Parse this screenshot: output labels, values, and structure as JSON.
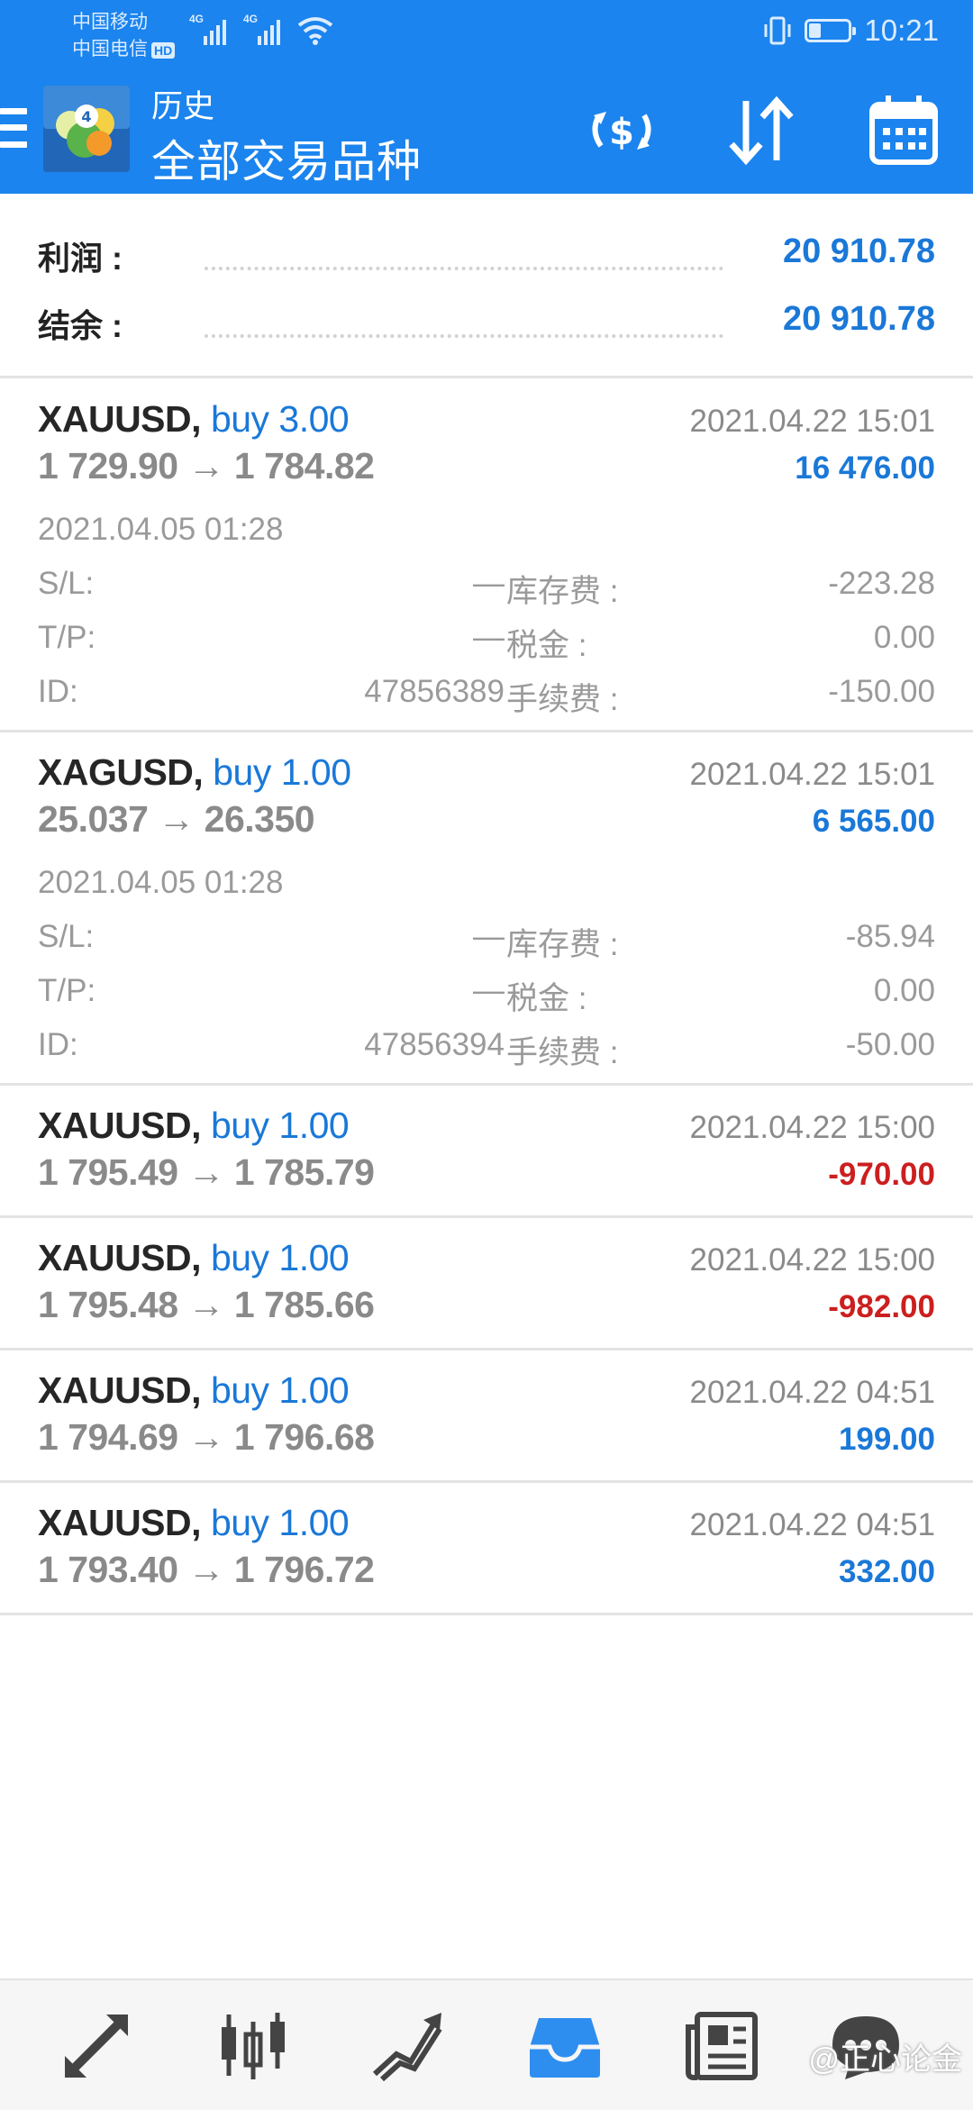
{
  "status_bar": {
    "carrier_1": "中国移动",
    "carrier_2": "中国电信",
    "hd_badge": "HD",
    "network_1": "4G",
    "network_2": "4G",
    "battery_level": 0.3,
    "time": "10:21"
  },
  "header": {
    "title": "历史",
    "subtitle": "全部交易品种",
    "bg_color": "#1b84ee"
  },
  "summary": {
    "profit_label": "利润 :",
    "profit_value": "20 910.78",
    "balance_label": "结余 :",
    "balance_value": "20 910.78"
  },
  "deals": [
    {
      "symbol": "XAUUSD,",
      "side": "buy 3.00",
      "prices": "1 729.90 → 1 784.82",
      "close_time": "2021.04.22 15:01",
      "profit": "16 476.00",
      "open_time": "2021.04.05 01:28",
      "sl_label": "S/L:",
      "sl": "—",
      "tp_label": "T/P:",
      "tp": "—",
      "id_label": "ID:",
      "id": "47856389",
      "swap_label": "库存费 :",
      "swap": "-223.28",
      "tax_label": "税金 :",
      "tax": "0.00",
      "fee_label": "手续费 :",
      "fee": "-150.00"
    },
    {
      "symbol": "XAGUSD,",
      "side": "buy 1.00",
      "prices": "25.037 → 26.350",
      "close_time": "2021.04.22 15:01",
      "profit": "6 565.00",
      "open_time": "2021.04.05 01:28",
      "sl_label": "S/L:",
      "sl": "—",
      "tp_label": "T/P:",
      "tp": "—",
      "id_label": "ID:",
      "id": "47856394",
      "swap_label": "库存费 :",
      "swap": "-85.94",
      "tax_label": "税金 :",
      "tax": "0.00",
      "fee_label": "手续费 :",
      "fee": "-50.00"
    },
    {
      "symbol": "XAUUSD,",
      "side": "buy 1.00",
      "prices": "1 795.49 → 1 785.79",
      "close_time": "2021.04.22 15:00",
      "profit": "-970.00"
    },
    {
      "symbol": "XAUUSD,",
      "side": "buy 1.00",
      "prices": "1 795.48 → 1 785.66",
      "close_time": "2021.04.22 15:00",
      "profit": "-982.00"
    },
    {
      "symbol": "XAUUSD,",
      "side": "buy 1.00",
      "prices": "1 794.69 → 1 796.68",
      "close_time": "2021.04.22 04:51",
      "profit": "199.00"
    },
    {
      "symbol": "XAUUSD,",
      "side": "buy 1.00",
      "prices": "1 793.40 → 1 796.72",
      "close_time": "2021.04.22 04:51",
      "profit": "332.00"
    }
  ],
  "colors": {
    "positive": "#1a78d8",
    "negative": "#cc1f1f",
    "nav_active": "#2e8ef0",
    "nav_inactive": "#444444"
  },
  "bottom_nav": {
    "items": [
      "quotes-icon",
      "chart-icon",
      "trade-icon",
      "history-icon",
      "news-icon",
      "chat-icon"
    ],
    "active_item": "history-icon"
  },
  "watermark": "@正心论金"
}
